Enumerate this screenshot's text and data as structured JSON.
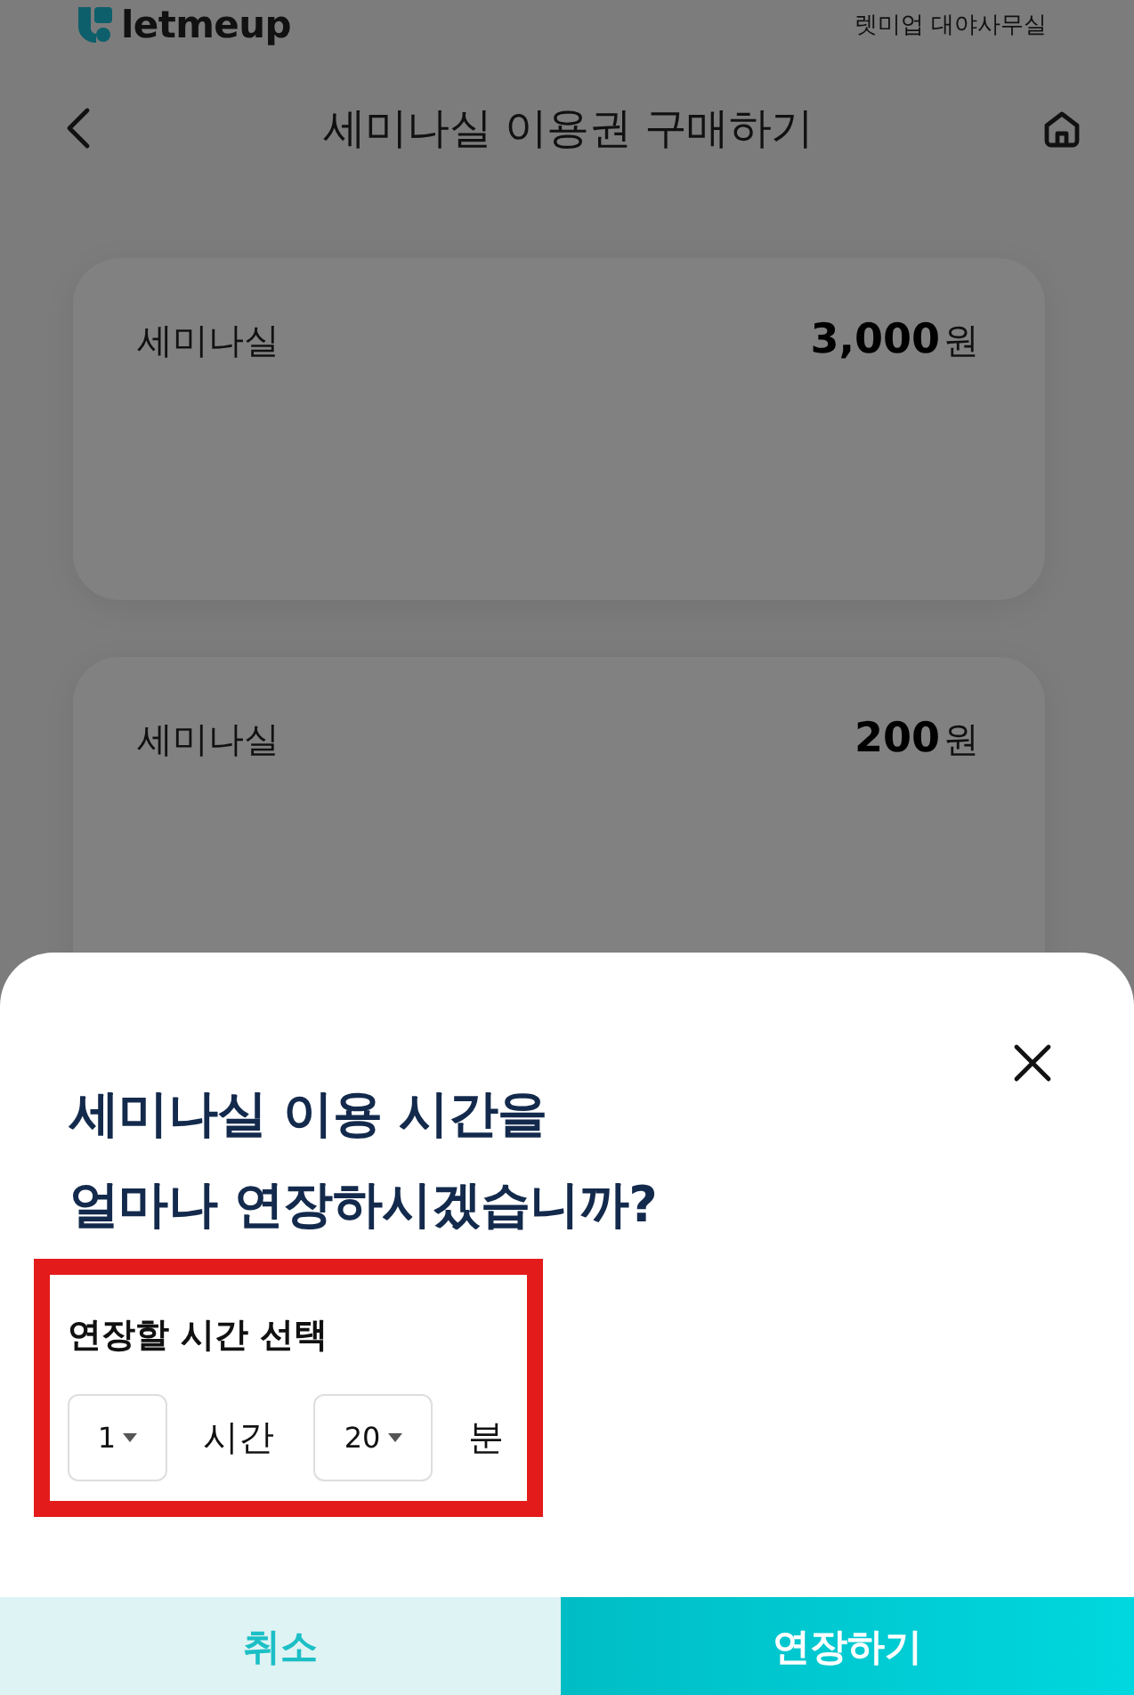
{
  "header": {
    "logo_text": "letmeup",
    "location": "렛미업 대야사무실"
  },
  "nav": {
    "title": "세미나실 이용권 구매하기"
  },
  "products": [
    {
      "name": "세미나실",
      "price": "3,000",
      "unit": "원"
    },
    {
      "name": "세미나실",
      "price": "200",
      "unit": "원"
    }
  ],
  "dialog": {
    "title_lines": [
      "세미나실 이용 시간을",
      "얼마나 연장하시겠습니까?"
    ],
    "picker": {
      "highlighted": true,
      "label": "연장할 시간 선택",
      "fields": [
        {
          "value": "1",
          "unit": "시간"
        },
        {
          "value": "20",
          "unit": "분"
        }
      ]
    },
    "buttons": [
      {
        "kind": "secondary",
        "label": "취소"
      },
      {
        "kind": "primary",
        "label": "연장하기"
      }
    ]
  }
}
